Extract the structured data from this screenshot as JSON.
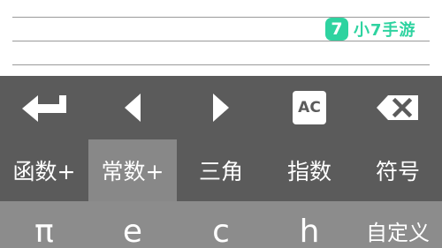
{
  "brand": {
    "mark": "7",
    "name": "小7手游",
    "color": "#2ed3a0"
  },
  "controls": {
    "enter_icon": "enter-icon",
    "left_icon": "arrow-left-icon",
    "right_icon": "arrow-right-icon",
    "clear_label": "AC",
    "backspace_icon": "backspace-icon"
  },
  "tabs": [
    {
      "label": "函数+",
      "active": false
    },
    {
      "label": "常数+",
      "active": true
    },
    {
      "label": "三角",
      "active": false
    },
    {
      "label": "指数",
      "active": false
    },
    {
      "label": "符号",
      "active": false
    }
  ],
  "constants": [
    {
      "label": "π"
    },
    {
      "label": "e"
    },
    {
      "label": "c"
    },
    {
      "label": "h"
    },
    {
      "label": "自定义"
    }
  ],
  "colors": {
    "keypad_dark": "#5b5b5b",
    "tab_active": "#888888",
    "keypad_light": "#8c8c8c"
  }
}
